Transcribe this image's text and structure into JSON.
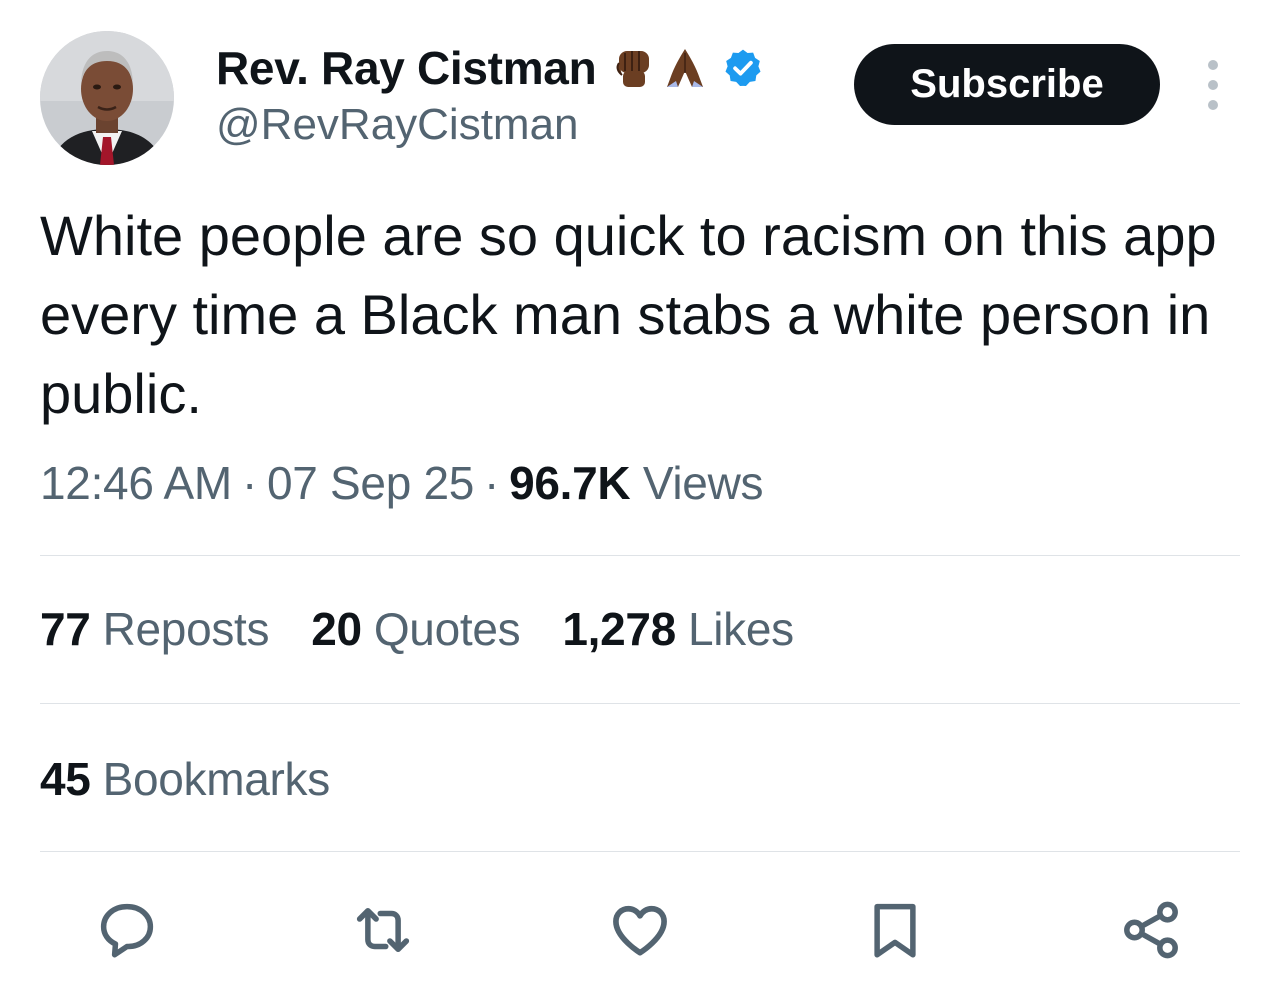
{
  "author": {
    "display_name": "Rev. Ray Cistman",
    "handle": "@RevRayCistman",
    "emojis": [
      "raised-fist-emoji",
      "folded-hands-emoji"
    ],
    "verified_icon": "verified-badge-icon",
    "verified_color": "#1d9bf0"
  },
  "header": {
    "subscribe_label": "Subscribe",
    "more_icon": "more-vertical-icon"
  },
  "tweet": {
    "text": "White people are so quick to racism on this app every time a Black man stabs a white person in public."
  },
  "meta": {
    "time": "12:46 AM",
    "separator": "·",
    "date": "07 Sep 25",
    "views_count": "96.7K",
    "views_label": "Views"
  },
  "stats": {
    "reposts_count": "77",
    "reposts_label": "Reposts",
    "quotes_count": "20",
    "quotes_label": "Quotes",
    "likes_count": "1,278",
    "likes_label": "Likes",
    "bookmarks_count": "45",
    "bookmarks_label": "Bookmarks"
  },
  "actions": [
    "reply-icon",
    "repost-icon",
    "like-icon",
    "bookmark-icon",
    "share-icon"
  ],
  "colors": {
    "text": "#0f1419",
    "secondary": "#536471",
    "divider": "#dfe3e7",
    "subscribe_bg": "#0f1419"
  }
}
